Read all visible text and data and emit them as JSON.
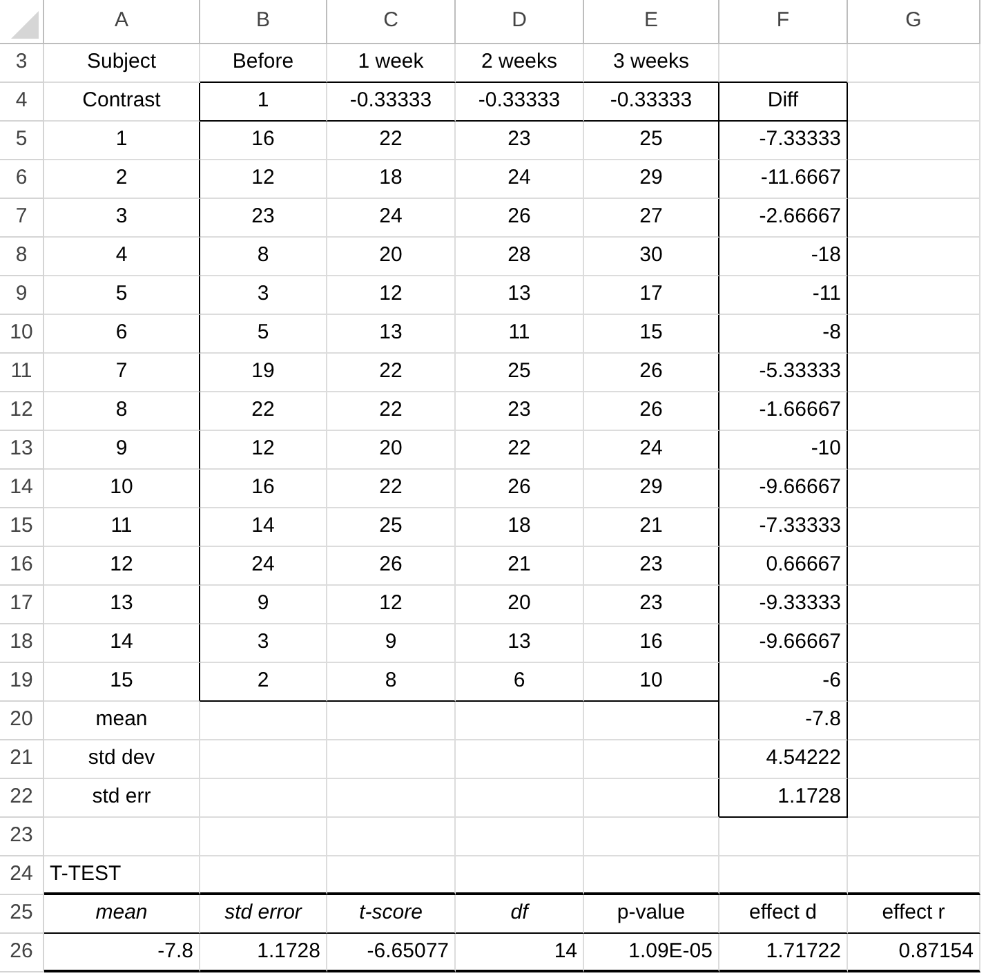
{
  "columns": [
    "A",
    "B",
    "C",
    "D",
    "E",
    "F",
    "G"
  ],
  "rows": [
    {
      "number": "3",
      "cells": [
        {
          "text": "Subject",
          "kind": "label"
        },
        {
          "text": "Before",
          "kind": "label"
        },
        {
          "text": "1 week",
          "kind": "label"
        },
        {
          "text": "2 weeks",
          "kind": "label"
        },
        {
          "text": "3 weeks",
          "kind": "label"
        },
        null,
        null
      ]
    },
    {
      "number": "4",
      "cells": [
        {
          "text": "Contrast",
          "kind": "label"
        },
        {
          "text": "1",
          "kind": "label"
        },
        {
          "text": "-0.33333",
          "kind": "label"
        },
        {
          "text": "-0.33333",
          "kind": "label"
        },
        {
          "text": "-0.33333",
          "kind": "label"
        },
        {
          "text": "Diff",
          "kind": "label"
        },
        null
      ]
    },
    {
      "number": "5",
      "cells": [
        {
          "text": "1",
          "kind": "label"
        },
        {
          "text": "16",
          "kind": "label"
        },
        {
          "text": "22",
          "kind": "label"
        },
        {
          "text": "23",
          "kind": "label"
        },
        {
          "text": "25",
          "kind": "label"
        },
        {
          "text": "-7.33333",
          "kind": "figure"
        },
        null
      ]
    },
    {
      "number": "6",
      "cells": [
        {
          "text": "2",
          "kind": "label"
        },
        {
          "text": "12",
          "kind": "label"
        },
        {
          "text": "18",
          "kind": "label"
        },
        {
          "text": "24",
          "kind": "label"
        },
        {
          "text": "29",
          "kind": "label"
        },
        {
          "text": "-11.6667",
          "kind": "figure"
        },
        null
      ]
    },
    {
      "number": "7",
      "cells": [
        {
          "text": "3",
          "kind": "label"
        },
        {
          "text": "23",
          "kind": "label"
        },
        {
          "text": "24",
          "kind": "label"
        },
        {
          "text": "26",
          "kind": "label"
        },
        {
          "text": "27",
          "kind": "label"
        },
        {
          "text": "-2.66667",
          "kind": "figure"
        },
        null
      ]
    },
    {
      "number": "8",
      "cells": [
        {
          "text": "4",
          "kind": "label"
        },
        {
          "text": "8",
          "kind": "label"
        },
        {
          "text": "20",
          "kind": "label"
        },
        {
          "text": "28",
          "kind": "label"
        },
        {
          "text": "30",
          "kind": "label"
        },
        {
          "text": "-18",
          "kind": "figure"
        },
        null
      ]
    },
    {
      "number": "9",
      "cells": [
        {
          "text": "5",
          "kind": "label"
        },
        {
          "text": "3",
          "kind": "label"
        },
        {
          "text": "12",
          "kind": "label"
        },
        {
          "text": "13",
          "kind": "label"
        },
        {
          "text": "17",
          "kind": "label"
        },
        {
          "text": "-11",
          "kind": "figure"
        },
        null
      ]
    },
    {
      "number": "10",
      "cells": [
        {
          "text": "6",
          "kind": "label"
        },
        {
          "text": "5",
          "kind": "label"
        },
        {
          "text": "13",
          "kind": "label"
        },
        {
          "text": "11",
          "kind": "label"
        },
        {
          "text": "15",
          "kind": "label"
        },
        {
          "text": "-8",
          "kind": "figure"
        },
        null
      ]
    },
    {
      "number": "11",
      "cells": [
        {
          "text": "7",
          "kind": "label"
        },
        {
          "text": "19",
          "kind": "label"
        },
        {
          "text": "22",
          "kind": "label"
        },
        {
          "text": "25",
          "kind": "label"
        },
        {
          "text": "26",
          "kind": "label"
        },
        {
          "text": "-5.33333",
          "kind": "figure"
        },
        null
      ]
    },
    {
      "number": "12",
      "cells": [
        {
          "text": "8",
          "kind": "label"
        },
        {
          "text": "22",
          "kind": "label"
        },
        {
          "text": "22",
          "kind": "label"
        },
        {
          "text": "23",
          "kind": "label"
        },
        {
          "text": "26",
          "kind": "label"
        },
        {
          "text": "-1.66667",
          "kind": "figure"
        },
        null
      ]
    },
    {
      "number": "13",
      "cells": [
        {
          "text": "9",
          "kind": "label"
        },
        {
          "text": "12",
          "kind": "label"
        },
        {
          "text": "20",
          "kind": "label"
        },
        {
          "text": "22",
          "kind": "label"
        },
        {
          "text": "24",
          "kind": "label"
        },
        {
          "text": "-10",
          "kind": "figure"
        },
        null
      ]
    },
    {
      "number": "14",
      "cells": [
        {
          "text": "10",
          "kind": "label"
        },
        {
          "text": "16",
          "kind": "label"
        },
        {
          "text": "22",
          "kind": "label"
        },
        {
          "text": "26",
          "kind": "label"
        },
        {
          "text": "29",
          "kind": "label"
        },
        {
          "text": "-9.66667",
          "kind": "figure"
        },
        null
      ]
    },
    {
      "number": "15",
      "cells": [
        {
          "text": "11",
          "kind": "label"
        },
        {
          "text": "14",
          "kind": "label"
        },
        {
          "text": "25",
          "kind": "label"
        },
        {
          "text": "18",
          "kind": "label"
        },
        {
          "text": "21",
          "kind": "label"
        },
        {
          "text": "-7.33333",
          "kind": "figure"
        },
        null
      ]
    },
    {
      "number": "16",
      "cells": [
        {
          "text": "12",
          "kind": "label"
        },
        {
          "text": "24",
          "kind": "label"
        },
        {
          "text": "26",
          "kind": "label"
        },
        {
          "text": "21",
          "kind": "label"
        },
        {
          "text": "23",
          "kind": "label"
        },
        {
          "text": "0.66667",
          "kind": "figure"
        },
        null
      ]
    },
    {
      "number": "17",
      "cells": [
        {
          "text": "13",
          "kind": "label"
        },
        {
          "text": "9",
          "kind": "label"
        },
        {
          "text": "12",
          "kind": "label"
        },
        {
          "text": "20",
          "kind": "label"
        },
        {
          "text": "23",
          "kind": "label"
        },
        {
          "text": "-9.33333",
          "kind": "figure"
        },
        null
      ]
    },
    {
      "number": "18",
      "cells": [
        {
          "text": "14",
          "kind": "label"
        },
        {
          "text": "3",
          "kind": "label"
        },
        {
          "text": "9",
          "kind": "label"
        },
        {
          "text": "13",
          "kind": "label"
        },
        {
          "text": "16",
          "kind": "label"
        },
        {
          "text": "-9.66667",
          "kind": "figure"
        },
        null
      ]
    },
    {
      "number": "19",
      "cells": [
        {
          "text": "15",
          "kind": "label"
        },
        {
          "text": "2",
          "kind": "label"
        },
        {
          "text": "8",
          "kind": "label"
        },
        {
          "text": "6",
          "kind": "label"
        },
        {
          "text": "10",
          "kind": "label"
        },
        {
          "text": "-6",
          "kind": "figure"
        },
        null
      ]
    },
    {
      "number": "20",
      "cells": [
        {
          "text": "mean",
          "kind": "label"
        },
        null,
        null,
        null,
        null,
        {
          "text": "-7.8",
          "kind": "figure"
        },
        null
      ]
    },
    {
      "number": "21",
      "cells": [
        {
          "text": "std dev",
          "kind": "label"
        },
        null,
        null,
        null,
        null,
        {
          "text": "4.54222",
          "kind": "figure"
        },
        null
      ]
    },
    {
      "number": "22",
      "cells": [
        {
          "text": "std err",
          "kind": "label"
        },
        null,
        null,
        null,
        null,
        {
          "text": "1.1728",
          "kind": "figure"
        },
        null
      ]
    },
    {
      "number": "23",
      "cells": [
        null,
        null,
        null,
        null,
        null,
        null,
        null
      ]
    },
    {
      "number": "24",
      "cells": [
        {
          "text": "T-TEST",
          "kind": "caption"
        },
        null,
        null,
        null,
        null,
        null,
        null
      ]
    },
    {
      "number": "25",
      "cells": [
        {
          "text": "mean",
          "kind": "label",
          "italic": true
        },
        {
          "text": "std error",
          "kind": "label",
          "italic": true
        },
        {
          "text": "t-score",
          "kind": "label",
          "italic": true
        },
        {
          "text": "df",
          "kind": "label",
          "italic": true
        },
        {
          "text": "p-value",
          "kind": "label",
          "italic": false
        },
        {
          "text": "effect d",
          "kind": "label",
          "italic": false
        },
        {
          "text": "effect r",
          "kind": "label",
          "italic": false
        }
      ]
    },
    {
      "number": "26",
      "cells": [
        {
          "text": "-7.8",
          "kind": "figure"
        },
        {
          "text": "1.1728",
          "kind": "figure"
        },
        {
          "text": "-6.65077",
          "kind": "figure"
        },
        {
          "text": "14",
          "kind": "figure"
        },
        {
          "text": "1.09E-05",
          "kind": "figure"
        },
        {
          "text": "1.71722",
          "kind": "figure"
        },
        {
          "text": "0.87154",
          "kind": "figure"
        }
      ]
    }
  ]
}
